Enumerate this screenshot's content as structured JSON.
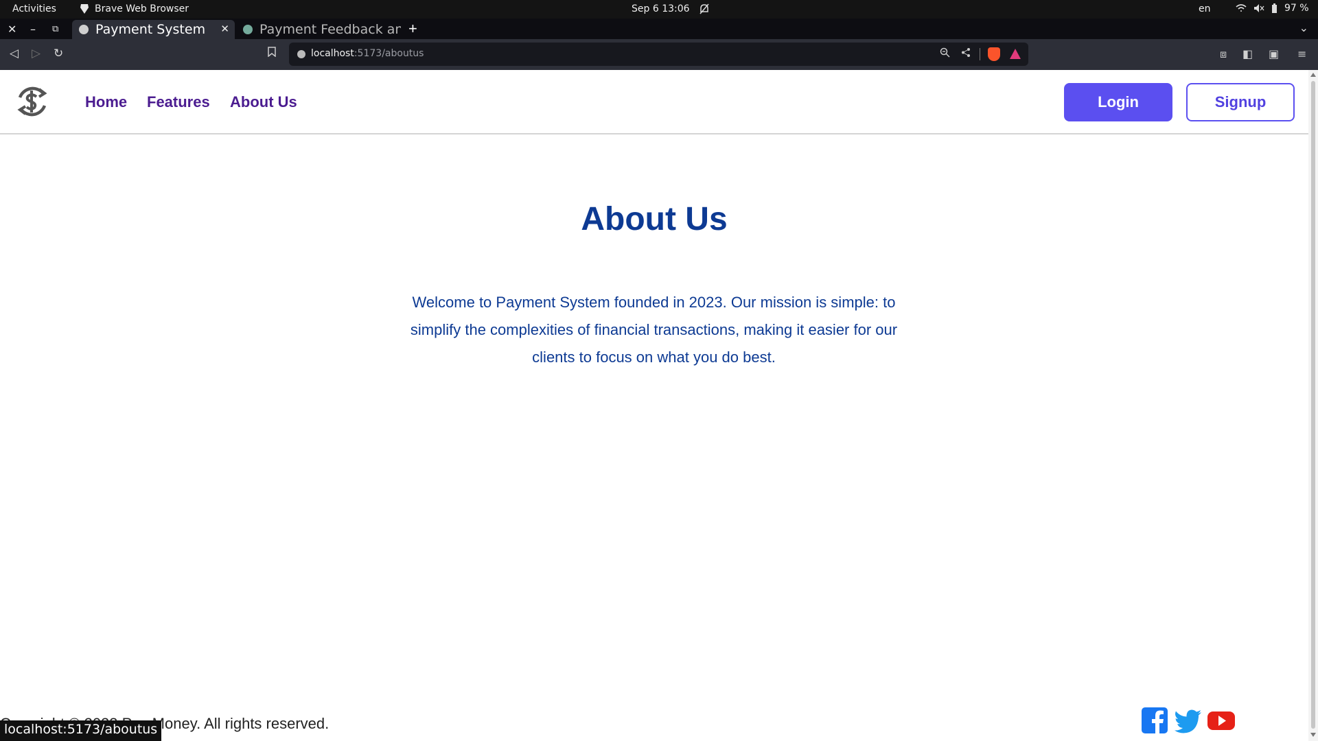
{
  "system_bar": {
    "activities": "Activities",
    "app_name": "Brave Web Browser",
    "clock": "Sep 6  13:06",
    "lang": "en",
    "battery": "97 %"
  },
  "browser": {
    "tabs": [
      {
        "title": "Payment System",
        "active": true
      },
      {
        "title": "Payment Feedback and",
        "active": false
      }
    ],
    "url_host": "localhost",
    "url_path": ":5173/aboutus",
    "status_tooltip": "localhost:5173/aboutus"
  },
  "navbar": {
    "links": [
      "Home",
      "Features",
      "About Us"
    ],
    "login_label": "Login",
    "signup_label": "Signup"
  },
  "main": {
    "heading": "About Us",
    "text": "Welcome to Payment System founded in 2023. Our mission is simple: to simplify the complexities of financial transactions, making it easier for our clients to focus on what you do best."
  },
  "footer": {
    "copyright": "Copyright © 2023 Pay Money. All rights reserved."
  },
  "colors": {
    "accent": "#5b4ff0",
    "nav_link": "#4b1c90",
    "heading": "#0d3a93"
  }
}
